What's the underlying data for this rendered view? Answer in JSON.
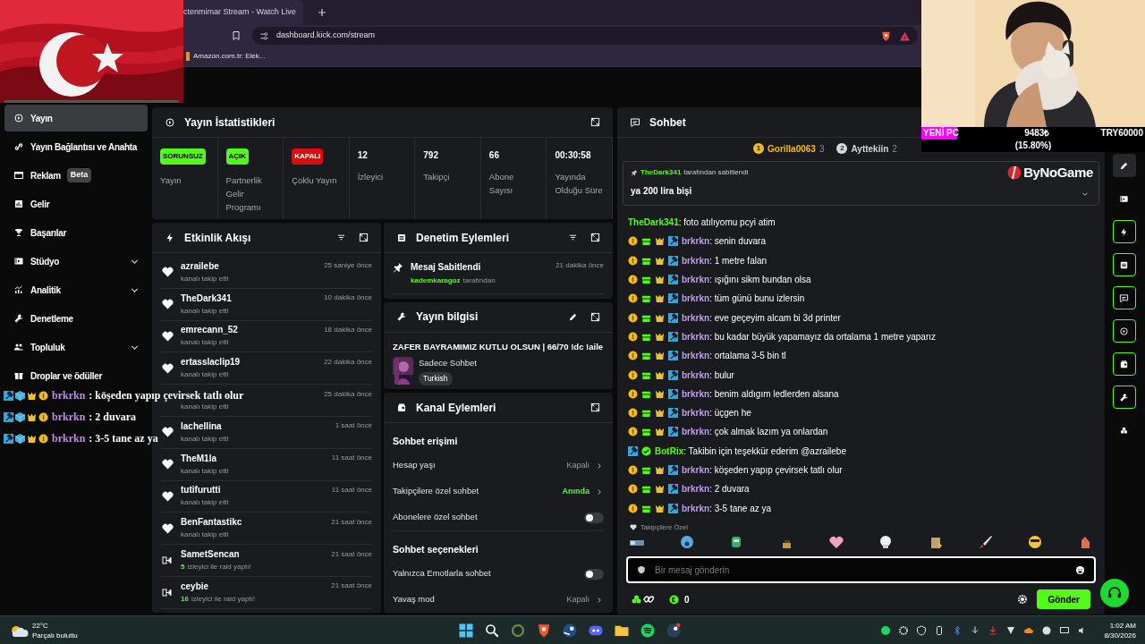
{
  "browser": {
    "tab_title": "ctenmimar Stream - Watch Live",
    "address": "dashboard.kick.com/stream",
    "bookmarks": [
      "Amazon.com.tr: Elek..."
    ]
  },
  "stream_overlay": {
    "goal": {
      "label": "YENİ PC",
      "amount": "9483₺",
      "percent": "(15.80%)",
      "target": "TRY60000",
      "level": 0.158
    },
    "brand": "ByNoGame",
    "chat_lines": [
      {
        "user": "brkrkn",
        "text": ": köşeden yapıp çevirsek tatlı olur"
      },
      {
        "user": "brkrkn",
        "text": ": 2 duvara"
      },
      {
        "user": "brkrkn",
        "text": ": 3-5 tane az ya"
      }
    ]
  },
  "sidebar": {
    "items": [
      {
        "label": "Yayın",
        "kind": "link",
        "selected": true
      },
      {
        "label": "Yayın Bağlantısı ve Anahta",
        "kind": "link",
        "selected": false
      },
      {
        "label": "Reklam",
        "kind": "link",
        "badge": "Beta",
        "selected": false
      },
      {
        "label": "Gelir",
        "kind": "link",
        "selected": false
      },
      {
        "label": "Başarılar",
        "kind": "link",
        "selected": false
      },
      {
        "label": "Stüdyo",
        "kind": "group",
        "selected": false
      },
      {
        "label": "Analitik",
        "kind": "group",
        "selected": false
      },
      {
        "label": "Denetleme",
        "kind": "link",
        "selected": false
      },
      {
        "label": "Topluluk",
        "kind": "group",
        "selected": false
      },
      {
        "label": "Droplar ve ödüller",
        "kind": "link",
        "selected": false
      }
    ]
  },
  "stream_stats": {
    "title": "Yayın İstatistikleri",
    "items": [
      {
        "kind": "status",
        "badge": "SORUNSUZ",
        "label": "Yayın",
        "color": "#53fc18"
      },
      {
        "kind": "status",
        "badge": "AÇIK",
        "label": "Partnerlik Gelir Programı",
        "color": "#53fc18"
      },
      {
        "kind": "status",
        "badge": "KAPALI",
        "label": "Çoklu Yayın",
        "color": "#d80f0f"
      },
      {
        "kind": "number",
        "value": "12",
        "label": "İzleyici"
      },
      {
        "kind": "number",
        "value": "792",
        "label": "Takipçi"
      },
      {
        "kind": "number",
        "value": "66",
        "label": "Abone Sayısı"
      },
      {
        "kind": "number",
        "value": "00:30:58",
        "label": "Yayında Olduğu Süre"
      }
    ]
  },
  "activity_feed": {
    "title": "Etkinlik Akışı",
    "events": [
      {
        "kind": "follow",
        "name": "azrailebe",
        "detail": "kanalı takip etti",
        "time": "25 saniye önce"
      },
      {
        "kind": "follow",
        "name": "TheDark341",
        "detail": "kanalı takip etti",
        "time": "10 dakika önce"
      },
      {
        "kind": "follow",
        "name": "emrecann_52",
        "detail": "kanalı takip etti",
        "time": "18 dakika önce"
      },
      {
        "kind": "follow",
        "name": "ertasslaclip19",
        "detail": "kanalı takip etti",
        "time": "22 dakika önce"
      },
      {
        "detail": "kanalı takip etti",
        "time": "25 dakika önce"
      },
      {
        "kind": "follow",
        "name": "lachellina",
        "detail": "kanalı takip etti",
        "time": "1 saat önce"
      },
      {
        "kind": "follow",
        "name": "TheM1la",
        "detail": "kanalı takip etti",
        "time": "11 saat önce"
      },
      {
        "kind": "follow",
        "name": "tutifurutti",
        "detail": "kanalı takip etti",
        "time": "11 saat önce"
      },
      {
        "kind": "follow",
        "name": "BenFantastikc",
        "detail": "kanalı takip etti",
        "time": "21 saat önce"
      },
      {
        "kind": "raid",
        "name": "SametSencan",
        "count": "5",
        "detail": "izleyici ile raid yaptı!",
        "time": "21 saat önce"
      },
      {
        "kind": "raid",
        "name": "ceybie",
        "count": "16",
        "detail": "izleyici ile raid yaptı!",
        "time": "21 saat önce"
      }
    ]
  },
  "moderation": {
    "title": "Denetim Eylemleri",
    "actions": [
      {
        "title": "Mesaj Sabitlendi",
        "user": "kademkaragoz",
        "suffix": "tarafından",
        "time": "21 dakika önce"
      }
    ]
  },
  "stream_info": {
    "title": "Yayın bilgisi",
    "stream_title": "ZAFER BAYRAMIMIZ KUTLU OLSUN | 66/70 !dc !aile",
    "category": "Sadece Sohbet",
    "tags": [
      "Turkish"
    ]
  },
  "channel_actions": {
    "title": "Kanal Eylemleri",
    "sections": [
      {
        "heading": "Sohbet erişimi",
        "rows": [
          {
            "kind": "select",
            "label": "Hesap yaşı",
            "value": "Kapalı",
            "active": false
          },
          {
            "kind": "select",
            "label": "Takipçilere özel sohbet",
            "value": "Anında",
            "active": true
          },
          {
            "kind": "toggle",
            "label": "Abonelere özel sohbet",
            "on": false
          }
        ]
      },
      {
        "heading": "Sohbet seçenekleri",
        "rows": [
          {
            "kind": "toggle",
            "label": "Yalnızca Emotlarla sohbet",
            "on": false
          },
          {
            "kind": "select",
            "label": "Yavaş mod",
            "value": "Kapalı",
            "active": false
          }
        ]
      }
    ]
  },
  "chat": {
    "title": "Sohbet",
    "leaderboard": [
      {
        "rank": "1",
        "name": "Gorilla0063",
        "count": "3",
        "color": "#f5b921"
      },
      {
        "rank": "2",
        "name": "Ayttekiin",
        "count": "2",
        "color": "#d7d7d7"
      }
    ],
    "pinned": {
      "user": "TheDark341",
      "by": "tarafından sabitlendi",
      "message": "ya 200 lira bişi"
    },
    "messages": [
      {
        "kind": "plain",
        "user": "TheDark341",
        "color": "#53fc18",
        "text": ": foto atılıyomu pcyi atim"
      },
      {
        "kind": "badged",
        "user": "brkrkn",
        "color": "#c39cf0",
        "text": ": senin duvara"
      },
      {
        "kind": "badged",
        "user": "brkrkn",
        "color": "#c39cf0",
        "text": ": 1 metre falan"
      },
      {
        "kind": "badged",
        "user": "brkrkn",
        "color": "#c39cf0",
        "text": ": ışığını sikm bundan olsa"
      },
      {
        "kind": "badged",
        "user": "brkrkn",
        "color": "#c39cf0",
        "text": ": tüm günü bunu izlersin"
      },
      {
        "kind": "badged",
        "user": "brkrkn",
        "color": "#c39cf0",
        "text": ": eve geçeyim alcam bi 3d printer"
      },
      {
        "kind": "badged",
        "user": "brkrkn",
        "color": "#c39cf0",
        "text": ": bu kadar büyük yapamayız da ortalama 1 metre yaparız"
      },
      {
        "kind": "badged",
        "user": "brkrkn",
        "color": "#c39cf0",
        "text": ": ortalama 3-5 bin tl"
      },
      {
        "kind": "badged",
        "user": "brkrkn",
        "color": "#c39cf0",
        "text": ": bulur"
      },
      {
        "kind": "badged",
        "user": "brkrkn",
        "color": "#c39cf0",
        "text": ": benim aldıgım ledlerden alsana"
      },
      {
        "kind": "badged",
        "user": "brkrkn",
        "color": "#c39cf0",
        "text": ": üçgen he"
      },
      {
        "kind": "badged",
        "user": "brkrkn",
        "color": "#c39cf0",
        "text": ": çok almak lazım ya onlardan"
      },
      {
        "kind": "bot",
        "user": "BotRix",
        "color": "#53fc18",
        "text": ": Takibin için teşekkür ederim @azrailebe"
      },
      {
        "kind": "badged",
        "user": "brkrkn",
        "color": "#c39cf0",
        "text": ": köşeden yapıp çevirsek tatlı olur"
      },
      {
        "kind": "badged",
        "user": "brkrkn",
        "color": "#c39cf0",
        "text": ": 2 duvara"
      },
      {
        "kind": "badged",
        "user": "brkrkn",
        "color": "#c39cf0",
        "text": ": 3-5 tane az ya"
      }
    ],
    "emote_section": "Takipçilere Özel",
    "input": {
      "placeholder": "Bir mesaj gönderin"
    },
    "kick_points": "0",
    "send_button": "Gönder"
  },
  "tool_rail": [
    {
      "kind": "filled"
    },
    {
      "kind": "plain"
    },
    {
      "kind": "outlined"
    },
    {
      "kind": "outlined"
    },
    {
      "kind": "outlined"
    },
    {
      "kind": "outlined"
    },
    {
      "kind": "outlined"
    },
    {
      "kind": "outlined"
    },
    {
      "kind": "plain"
    }
  ],
  "taskbar": {
    "weather": {
      "temp": "22°C",
      "condition": "Parçalı bulutlu"
    },
    "clock": {
      "time": "1:02 AM",
      "date": "8/30/2026"
    }
  }
}
